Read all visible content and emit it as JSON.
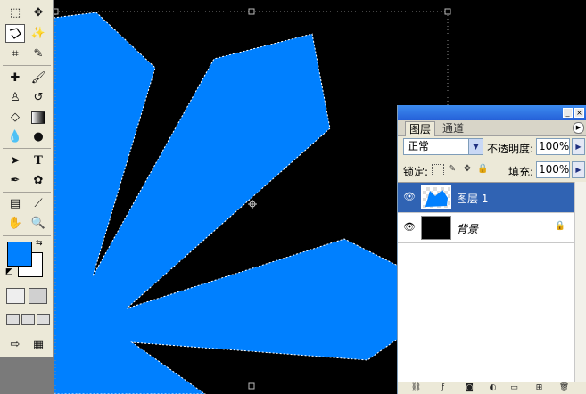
{
  "colors": {
    "foreground": "#0080ff",
    "background": "#ffffff",
    "canvas": "#000000",
    "shape": "#0080ff",
    "selection": "#3063b3"
  },
  "toolbox": {
    "tools": [
      "marquee-icon",
      "move-icon",
      "polygonal-lasso-icon",
      "magic-wand-icon",
      "crop-icon",
      "slice-icon",
      "healing-brush-icon",
      "brush-icon",
      "clone-stamp-icon",
      "history-brush-icon",
      "eraser-icon",
      "gradient-icon",
      "blur-icon",
      "dodge-icon",
      "path-selection-icon",
      "type-icon",
      "pen-icon",
      "custom-shape-icon",
      "notes-icon",
      "eyedropper-icon",
      "hand-icon",
      "zoom-icon"
    ]
  },
  "layers_panel": {
    "tabs": [
      "图层",
      "通道"
    ],
    "blend_mode": "正常",
    "opacity_label": "不透明度:",
    "opacity_value": "100%",
    "lock_label": "锁定:",
    "fill_label": "填充:",
    "fill_value": "100%",
    "layers": [
      {
        "name": "图层 1",
        "selected": true,
        "locked": false
      },
      {
        "name": "背景",
        "selected": false,
        "locked": true
      }
    ]
  }
}
